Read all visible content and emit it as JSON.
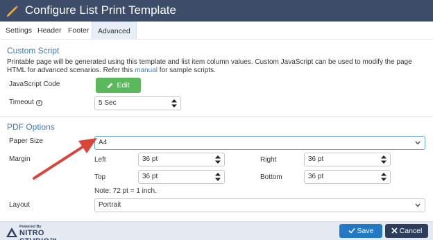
{
  "window": {
    "title": "Configure List Print Template"
  },
  "tabs": [
    {
      "label": "Settings"
    },
    {
      "label": "Header"
    },
    {
      "label": "Footer"
    },
    {
      "label": "Advanced",
      "active": true
    }
  ],
  "custom_script": {
    "title": "Custom Script",
    "description_main": "Printable page will be generated using this template and list item column values. Custom JavaScript can be used to modify the page HTML for advanced scenarios. Refer this ",
    "description_link": "manual",
    "description_end": " for sample scripts.",
    "js_label": "JavaScript Code",
    "edit_label": "Edit",
    "timeout_label": "Timeout",
    "timeout_info_icon": "i",
    "timeout_value": "5 Sec"
  },
  "pdf_options": {
    "title": "PDF Options",
    "paper_size_label": "Paper Size",
    "paper_size_value": "A4",
    "margin_label": "Margin",
    "left_label": "Left",
    "left_value": "36 pt",
    "right_label": "Right",
    "right_value": "36 pt",
    "top_label": "Top",
    "top_value": "36 pt",
    "bottom_label": "Bottom",
    "bottom_value": "36 pt",
    "note": "Note: 72 pt = 1 inch.",
    "layout_label": "Layout",
    "layout_value": "Portrait"
  },
  "footer": {
    "powered_by": "Powered By",
    "brand": "NITRO STUDIO™",
    "save_label": "Save",
    "cancel_label": "Cancel"
  },
  "colors": {
    "titlebar": "#3d4c69",
    "accent": "#3f7abb",
    "edit_button": "#5cb85c",
    "save_button": "#2479c4",
    "cancel_button": "#2d3d5a",
    "arrow": "#d9453a",
    "pencil": "#f0a830"
  },
  "icons": {
    "title": "pencil-icon",
    "edit": "pencil-icon",
    "timeout_info": "info-icon",
    "spinner": "spinner-arrows-icon",
    "select": "chevron-down-icon",
    "save": "check-icon",
    "cancel": "close-icon",
    "annotation": "red-arrow-icon",
    "brand": "nitro-logo-icon"
  }
}
